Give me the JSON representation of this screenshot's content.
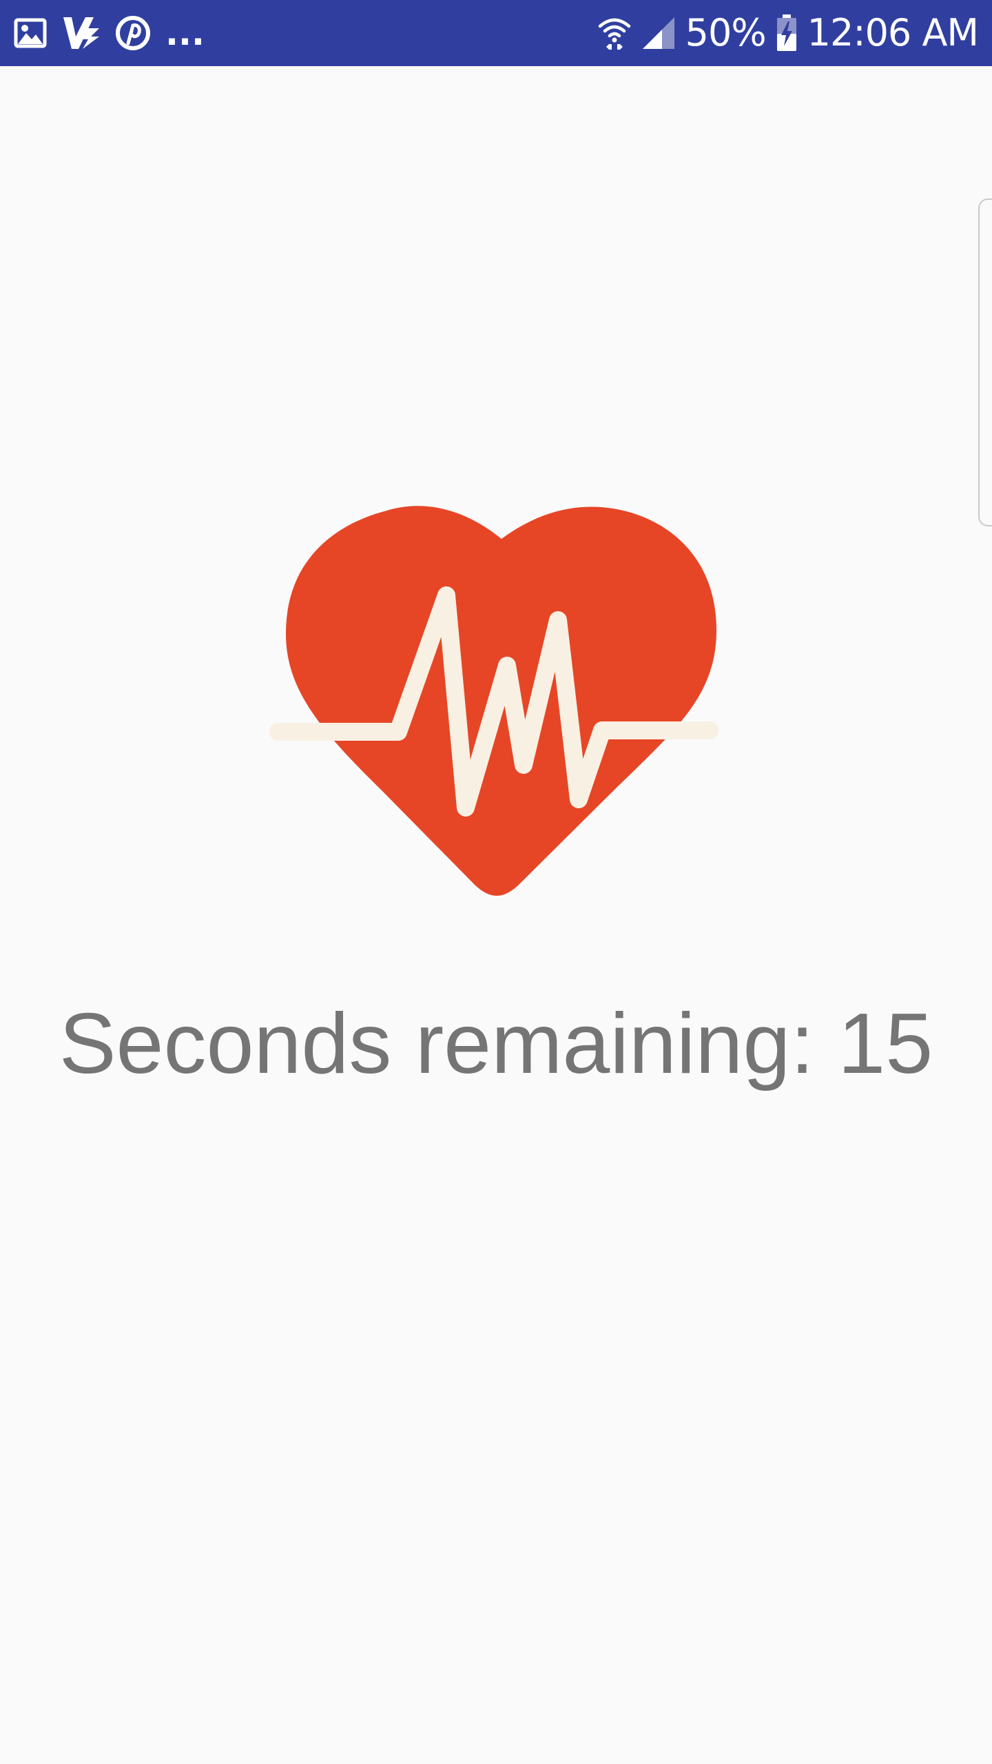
{
  "status_bar": {
    "left_icons": [
      "gallery-icon",
      "vpn-icon",
      "pinterest-icon"
    ],
    "overflow": "...",
    "battery_percent": "50%",
    "time": "12:06 AM",
    "right_icons": [
      "wifi-icon",
      "signal-icon",
      "battery-charging-icon"
    ],
    "background_color": "#303f9f"
  },
  "main": {
    "logo_icon": "heart-pulse-icon",
    "heart_color": "#e64626",
    "pulse_color": "#f8f0e3",
    "countdown_label": "Seconds remaining: 15",
    "countdown_color": "#757575"
  }
}
